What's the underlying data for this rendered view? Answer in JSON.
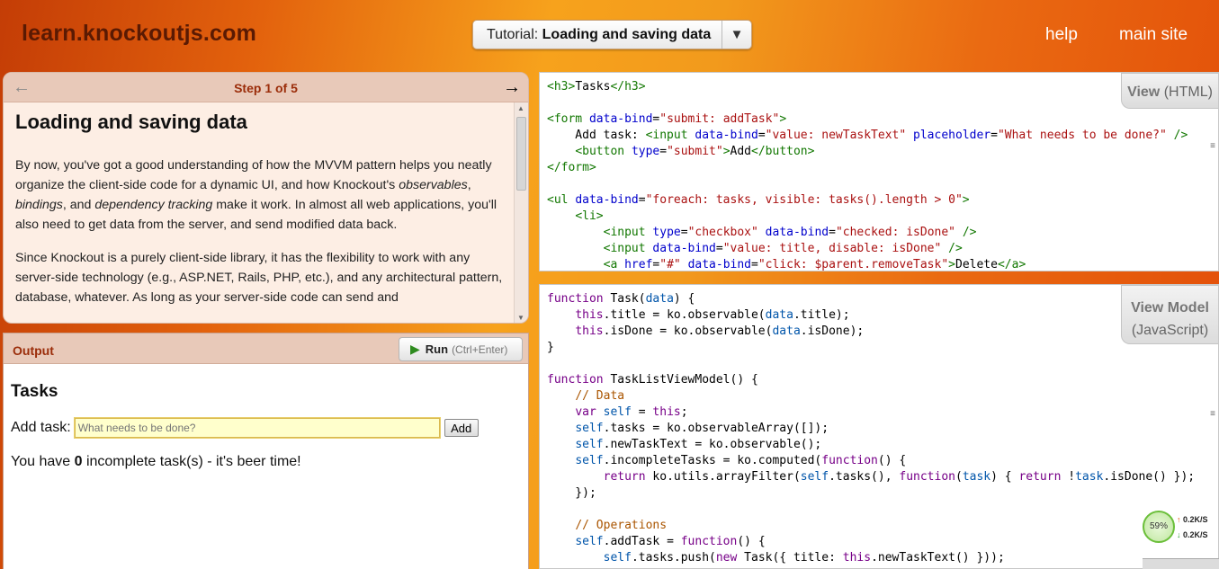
{
  "header": {
    "logo": "learn.knockoutjs.com",
    "tutorial_prefix": "Tutorial:",
    "tutorial_title": "Loading and saving data",
    "help": "help",
    "main_site": "main site"
  },
  "step": {
    "counter": "Step 1 of 5",
    "prev_icon": "←",
    "next_icon": "→",
    "title": "Loading and saving data",
    "p1_a": "By now, you've got a good understanding of how the MVVM pattern helps you neatly organize the client-side code for a dynamic UI, and how Knockout's ",
    "p1_obs": "observables",
    "p1_b": ", ",
    "p1_bind": "bindings",
    "p1_c": ", and ",
    "p1_dep": "dependency tracking",
    "p1_d": " make it work. In almost all web applications, you'll also need to get data from the server, and send modified data back.",
    "p2": "Since Knockout is a purely client-side library, it has the flexibility to work with any server-side technology (e.g., ASP.NET, Rails, PHP, etc.), and any architectural pattern, database, whatever. As long as your server-side code can send and"
  },
  "output": {
    "title": "Output",
    "run_label": "Run",
    "run_shortcut": "(Ctrl+Enter)",
    "heading": "Tasks",
    "add_label": "Add task:",
    "input_placeholder": "What needs to be done?",
    "add_button": "Add",
    "status_before": "You have ",
    "status_count": "0",
    "status_after": " incomplete task(s) - it's beer time!"
  },
  "view_panel": {
    "tab_label": "View",
    "tab_sub": "(HTML)"
  },
  "vm_panel": {
    "tab_label": "View Model",
    "tab_sub": "(JavaScript)"
  },
  "net": {
    "percent": "59%",
    "up": "0.2K/S",
    "down": "0.2K/S"
  },
  "colors": {
    "brand_dark": "#5a1a03",
    "step_header": "#9b2d0a",
    "input_bg": "#ffffcc"
  }
}
